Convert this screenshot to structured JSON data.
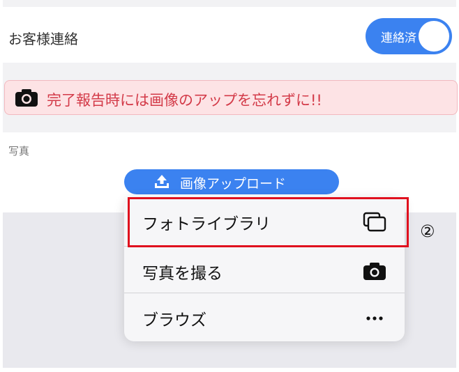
{
  "contact": {
    "label": "お客様連絡",
    "toggle_label": "連絡済",
    "toggle_on": true
  },
  "alert": {
    "icon": "camera-icon",
    "text": "完了報告時には画像のアップを忘れずに!!"
  },
  "photo": {
    "label": "写真"
  },
  "upload_button": {
    "icon": "upload-icon",
    "label": "画像アップロード"
  },
  "menu": {
    "items": [
      {
        "label": "フォトライブラリ",
        "icon": "photo-library-icon"
      },
      {
        "label": "写真を撮る",
        "icon": "camera-icon"
      },
      {
        "label": "ブラウズ",
        "icon": "more-icon"
      }
    ]
  },
  "annotation": {
    "callout": "②"
  },
  "colors": {
    "accent": "#3b82f0",
    "alert_text": "#d33a48",
    "alert_bg": "#fde3e5",
    "highlight": "#e0101e"
  }
}
